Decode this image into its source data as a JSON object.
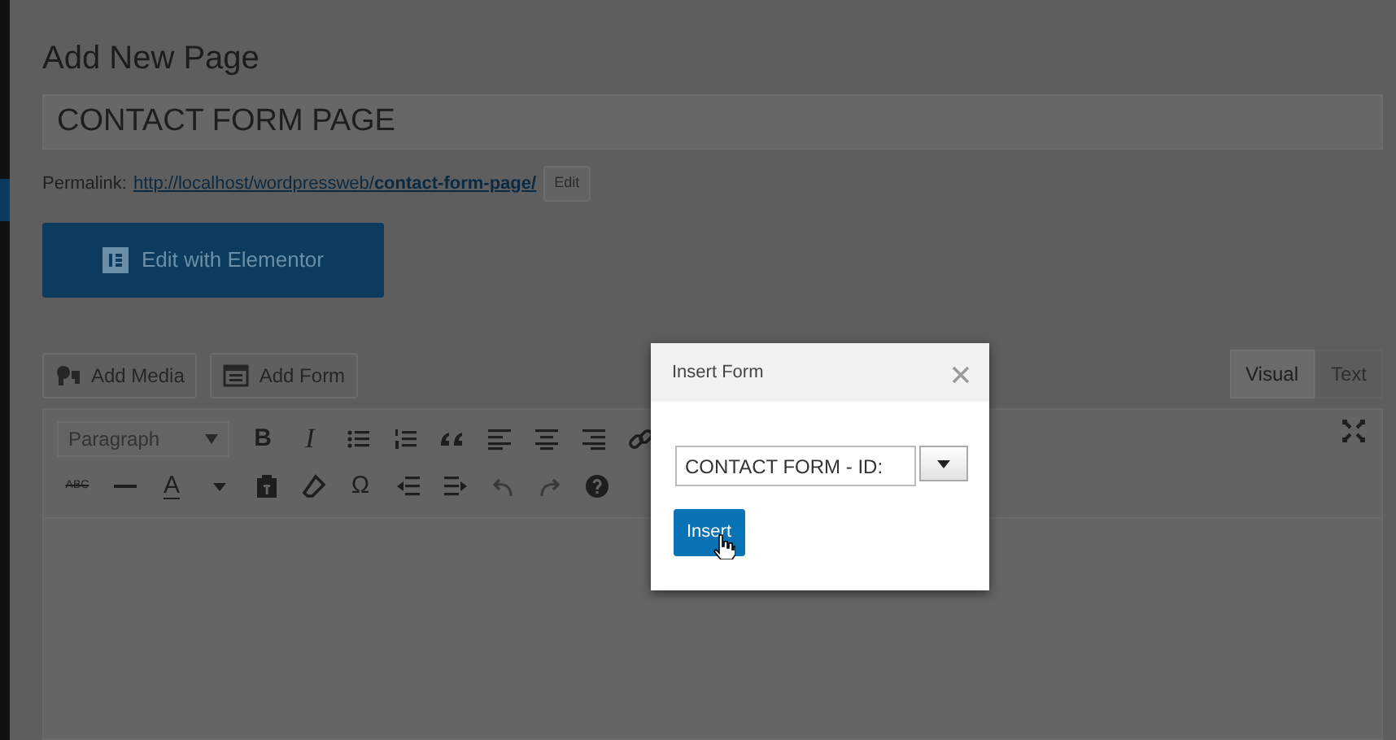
{
  "page": {
    "heading": "Add New Page",
    "title_value": "CONTACT FORM PAGE",
    "permalink": {
      "label": "Permalink:",
      "url": "http://localhost/wordpressweb/**contact-form-page/**",
      "edit_button": "Edit"
    },
    "elementor_button": "Edit with Elementor",
    "media_buttons": [
      {
        "kind": "media",
        "label": "Add Media"
      },
      {
        "kind": "form",
        "label": "Add Form"
      }
    ],
    "editor_tabs": [
      {
        "label": "Visual",
        "selected": true
      },
      {
        "label": "Text",
        "selected": false
      }
    ],
    "format_select": "Paragraph",
    "toolbar_rows": [
      [
        {
          "kind": "bold",
          "label": "B"
        },
        {
          "kind": "italic",
          "label": "I"
        },
        {
          "kind": "bullist"
        },
        {
          "kind": "numlist"
        },
        {
          "kind": "blockquote"
        },
        {
          "kind": "alignleft"
        },
        {
          "kind": "aligncenter"
        },
        {
          "kind": "alignright"
        },
        {
          "kind": "link"
        }
      ],
      [
        {
          "kind": "strike",
          "label": "ABC"
        },
        {
          "kind": "hr"
        },
        {
          "kind": "forecolor",
          "label": "A"
        },
        {
          "kind": "caret"
        },
        {
          "kind": "pastetext"
        },
        {
          "kind": "eraser"
        },
        {
          "kind": "charmap",
          "label": "Ω"
        },
        {
          "kind": "outdent"
        },
        {
          "kind": "indent"
        },
        {
          "kind": "undo"
        },
        {
          "kind": "redo"
        },
        {
          "kind": "help"
        }
      ]
    ]
  },
  "dialog": {
    "title": "Insert Form",
    "select_value": "CONTACT FORM - ID:",
    "button": "Insert"
  }
}
